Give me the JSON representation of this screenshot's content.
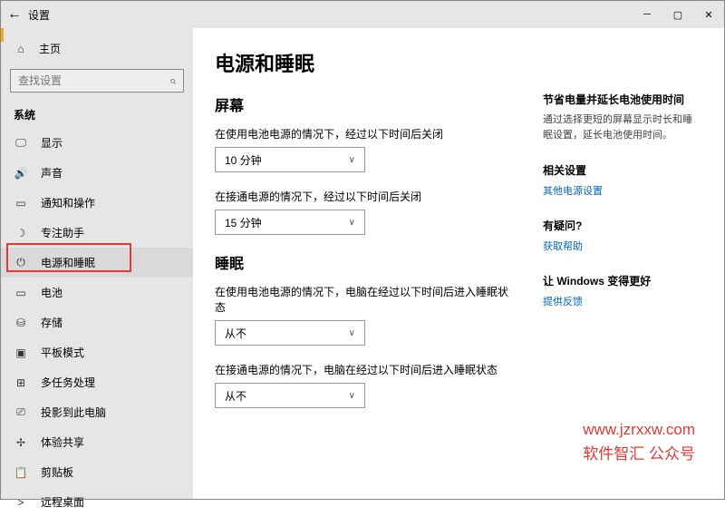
{
  "titlebar": {
    "title": "设置"
  },
  "sidebar": {
    "home": "主页",
    "search_placeholder": "查找设置",
    "category": "系统",
    "items": [
      {
        "label": "显示"
      },
      {
        "label": "声音"
      },
      {
        "label": "通知和操作"
      },
      {
        "label": "专注助手"
      },
      {
        "label": "电源和睡眠"
      },
      {
        "label": "电池"
      },
      {
        "label": "存储"
      },
      {
        "label": "平板模式"
      },
      {
        "label": "多任务处理"
      },
      {
        "label": "投影到此电脑"
      },
      {
        "label": "体验共享"
      },
      {
        "label": "剪贴板"
      },
      {
        "label": "远程桌面"
      }
    ]
  },
  "content": {
    "heading": "电源和睡眠",
    "screen_heading": "屏幕",
    "screen_battery_label": "在使用电池电源的情况下，经过以下时间后关闭",
    "screen_battery_value": "10 分钟",
    "screen_plugged_label": "在接通电源的情况下，经过以下时间后关闭",
    "screen_plugged_value": "15 分钟",
    "sleep_heading": "睡眠",
    "sleep_battery_label": "在使用电池电源的情况下，电脑在经过以下时间后进入睡眠状态",
    "sleep_battery_value": "从不",
    "sleep_plugged_label": "在接通电源的情况下，电脑在经过以下时间后进入睡眠状态",
    "sleep_plugged_value": "从不"
  },
  "aside": {
    "save_title": "节省电量并延长电池使用时间",
    "save_text": "通过选择更短的屏幕显示时长和睡眠设置，延长电池使用时间。",
    "related_title": "相关设置",
    "related_link": "其他电源设置",
    "question_title": "有疑问?",
    "question_link": "获取帮助",
    "better_title": "让 Windows 变得更好",
    "better_link": "提供反馈"
  },
  "watermark": {
    "line1": "www.jzrxxw.com",
    "line2": "软件智汇 公众号"
  }
}
